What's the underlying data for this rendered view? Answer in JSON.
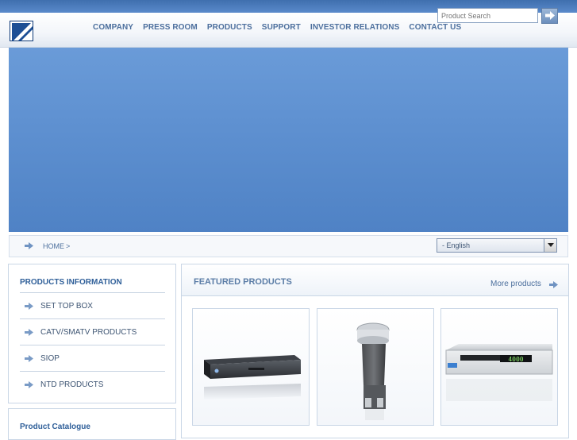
{
  "header": {
    "nav": [
      "COMPANY",
      "PRESS ROOM",
      "PRODUCTS",
      "SUPPORT",
      "INVESTOR RELATIONS",
      "CONTACT US"
    ],
    "search": {
      "placeholder": "Product Search"
    }
  },
  "breadcrumb": {
    "home": "HOME",
    "separator": ">"
  },
  "language": {
    "selected": "- English"
  },
  "sidebar": {
    "title": "PRODUCTS INFORMATION",
    "items": [
      {
        "label": "SET TOP BOX"
      },
      {
        "label": "CATV/SMATV PRODUCTS"
      },
      {
        "label": "SIOP"
      },
      {
        "label": "NTD PRODUCTS"
      }
    ],
    "catalogue_title": "Product Catalogue"
  },
  "featured": {
    "title": "FEATURED PRODUCTS",
    "more_label": "More products",
    "products": [
      {
        "icon": "set-top-box-image",
        "display": ""
      },
      {
        "icon": "lnb-image",
        "display": ""
      },
      {
        "icon": "receiver-image",
        "display": "4000"
      }
    ]
  },
  "colors": {
    "brand": "#1d4f95",
    "nav_text": "#4c6f9d",
    "banner": "#5f91d1",
    "heading": "#2f5f99"
  }
}
